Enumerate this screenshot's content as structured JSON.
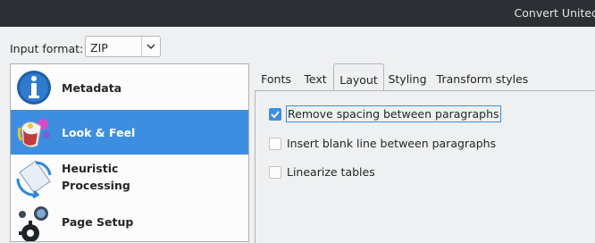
{
  "window": {
    "title": "Convert United"
  },
  "input_format": {
    "label": "Input format:",
    "value": "ZIP"
  },
  "sidebar": {
    "items": [
      {
        "label": "Metadata",
        "icon": "info-icon"
      },
      {
        "label": "Look & Feel",
        "icon": "paint-bucket-icon"
      },
      {
        "label": "Heuristic Processing",
        "icon": "heuristic-icon"
      },
      {
        "label": "Page Setup",
        "icon": "gear-icon"
      }
    ]
  },
  "tabs": [
    "Fonts",
    "Text",
    "Layout",
    "Styling",
    "Transform styles"
  ],
  "active_tab": "Layout",
  "layout_options": [
    {
      "label": "Remove spacing between paragraphs",
      "checked": true
    },
    {
      "label": "Insert blank line between paragraphs",
      "checked": false
    },
    {
      "label": "Linearize tables",
      "checked": false
    }
  ],
  "colors": {
    "accent": "#3d8ee0",
    "titlebar": "#2c2f33",
    "window_bg": "#eff0f1"
  }
}
